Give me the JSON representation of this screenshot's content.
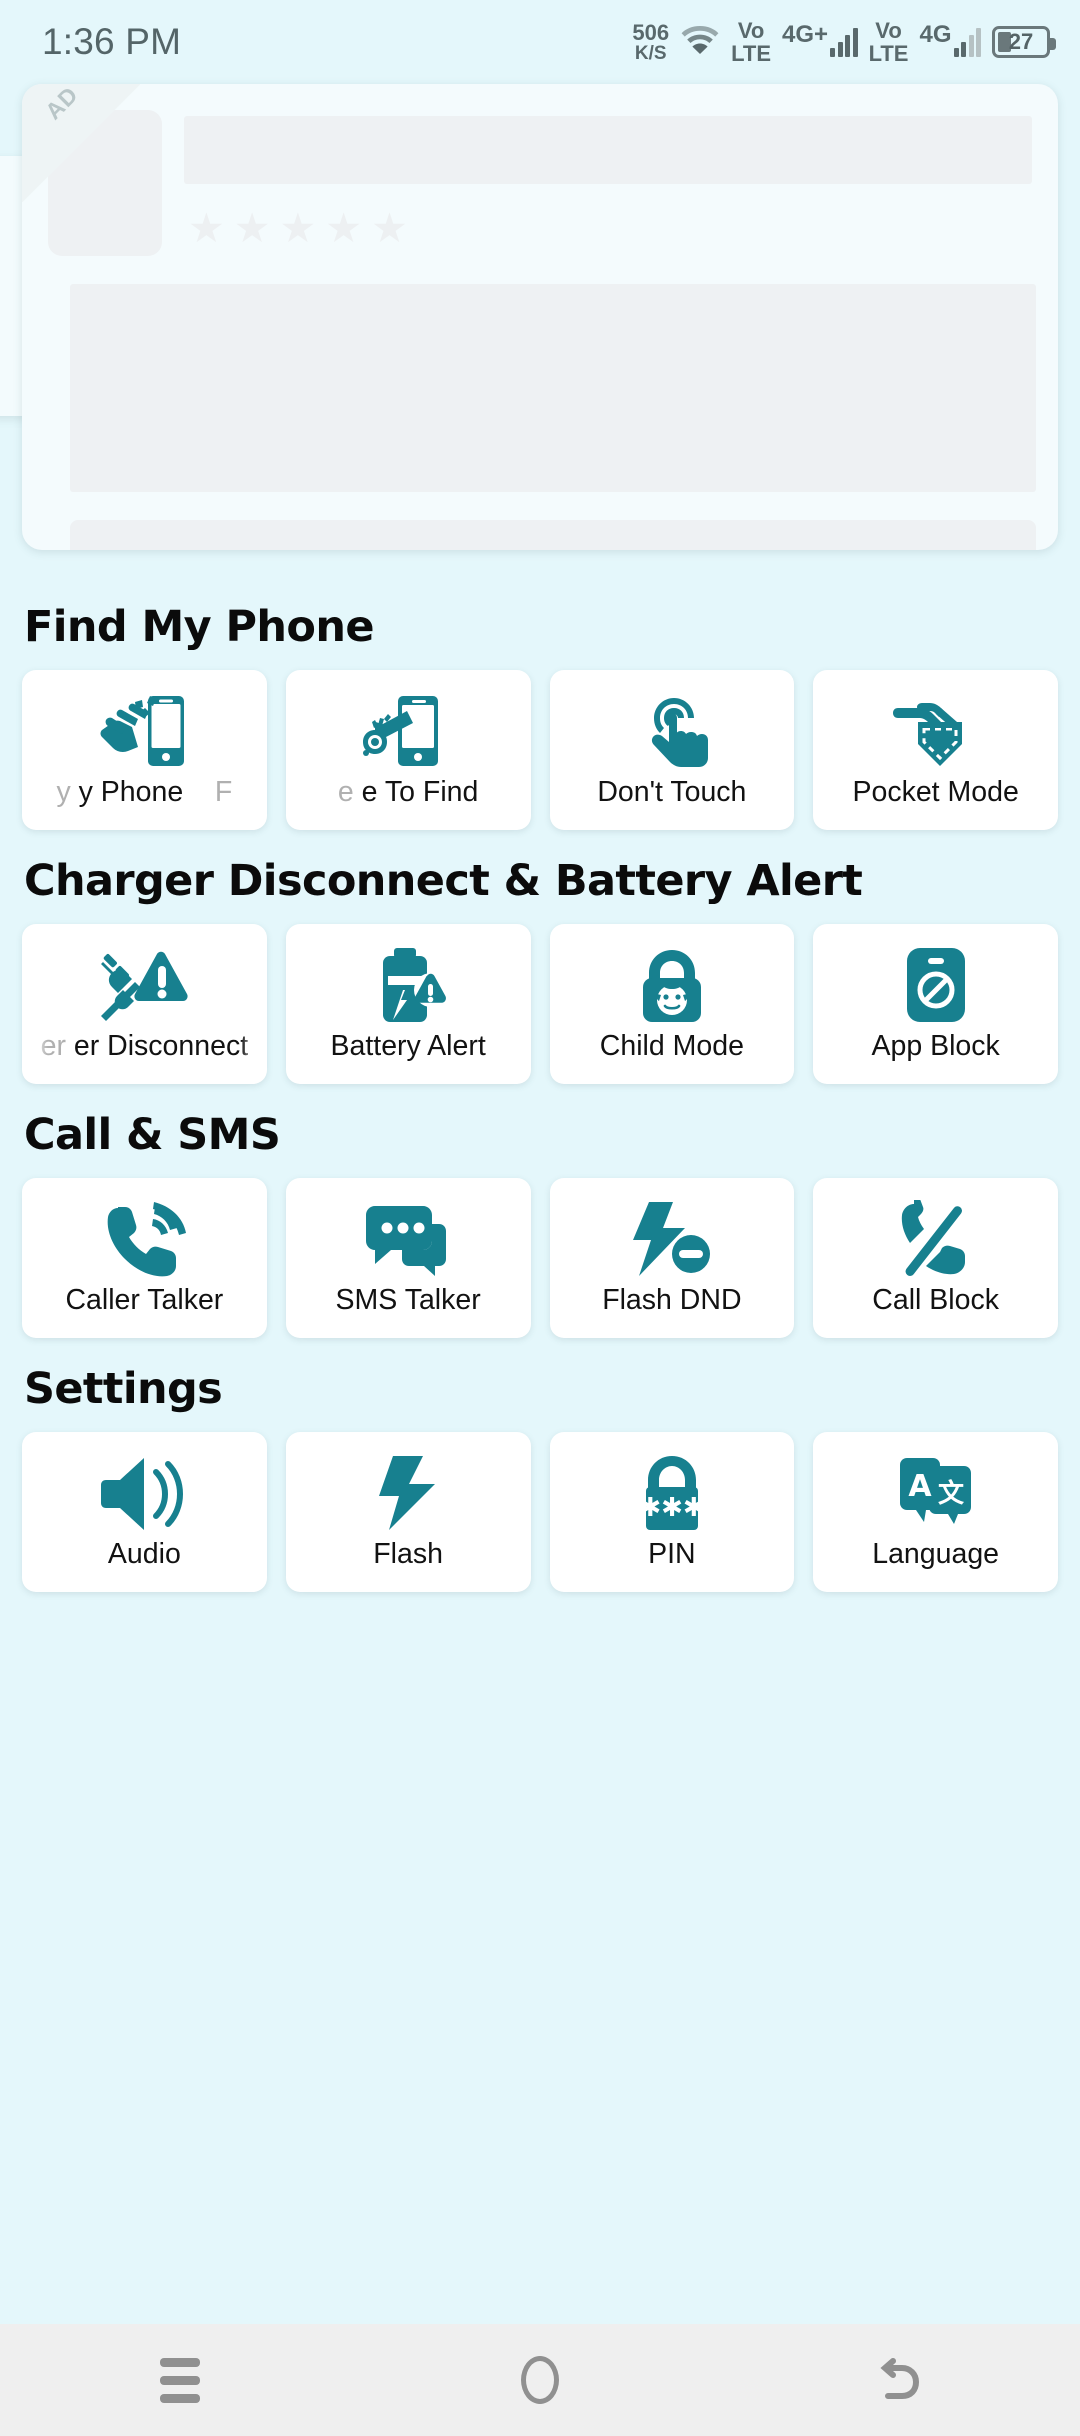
{
  "status_bar": {
    "time": "1:36 PM",
    "net_speed_value": "506",
    "net_speed_unit": "K/S",
    "wifi_icon": "wifi-icon",
    "sim1_volte": "Vo",
    "sim1_volte2": "LTE",
    "sim1_gen": "4G+",
    "sim2_volte": "Vo",
    "sim2_volte2": "LTE",
    "sim2_gen": "4G",
    "battery_percent": "27"
  },
  "ad": {
    "badge_label": "AD",
    "star_glyph": "★",
    "stars_count": 5
  },
  "sections": [
    {
      "title": "Find My Phone",
      "tiles": [
        {
          "label": "y Phone",
          "label_full": "Clap To Find My Phone",
          "label_trailing": "F",
          "marquee": true,
          "icon": "clap-phone-icon"
        },
        {
          "label": "e To Find",
          "label_full": "Whistle To Find",
          "marquee": true,
          "icon": "whistle-phone-icon"
        },
        {
          "label": "Don't Touch",
          "marquee": false,
          "icon": "touch-gesture-icon"
        },
        {
          "label": "Pocket Mode",
          "marquee": false,
          "icon": "pocket-icon"
        }
      ]
    },
    {
      "title": "Charger Disconnect & Battery Alert",
      "tiles": [
        {
          "label": "er Disconnect",
          "label_full": "Charger Disconnect",
          "marquee": true,
          "icon": "charger-warning-icon"
        },
        {
          "label": "Battery Alert",
          "marquee": false,
          "icon": "battery-alert-icon"
        },
        {
          "label": "Child Mode",
          "marquee": false,
          "icon": "child-lock-icon"
        },
        {
          "label": "App Block",
          "marquee": false,
          "icon": "app-block-icon"
        }
      ]
    },
    {
      "title": "Call & SMS",
      "tiles": [
        {
          "label": "Caller Talker",
          "marquee": false,
          "icon": "ringing-phone-icon"
        },
        {
          "label": "SMS Talker",
          "marquee": false,
          "icon": "chat-bubbles-icon"
        },
        {
          "label": "Flash DND",
          "marquee": false,
          "icon": "flash-dnd-icon"
        },
        {
          "label": "Call Block",
          "marquee": false,
          "icon": "call-block-icon"
        }
      ]
    },
    {
      "title": "Settings",
      "tiles": [
        {
          "label": "Audio",
          "marquee": false,
          "icon": "speaker-icon"
        },
        {
          "label": "Flash",
          "marquee": false,
          "icon": "lightning-icon"
        },
        {
          "label": "PIN",
          "marquee": false,
          "icon": "padlock-pin-icon"
        },
        {
          "label": "Language",
          "marquee": false,
          "icon": "translate-icon"
        }
      ]
    }
  ],
  "nav_bar": {
    "recents_icon": "hamburger-icon",
    "home_icon": "home-circle-icon",
    "back_icon": "back-arrow-icon"
  },
  "colors": {
    "accent_teal": "#17808f",
    "background": "#e4f7fb",
    "tile_bg": "#ffffff",
    "placeholder_gray": "#eef1f3",
    "navbar_bg": "#efefef"
  }
}
